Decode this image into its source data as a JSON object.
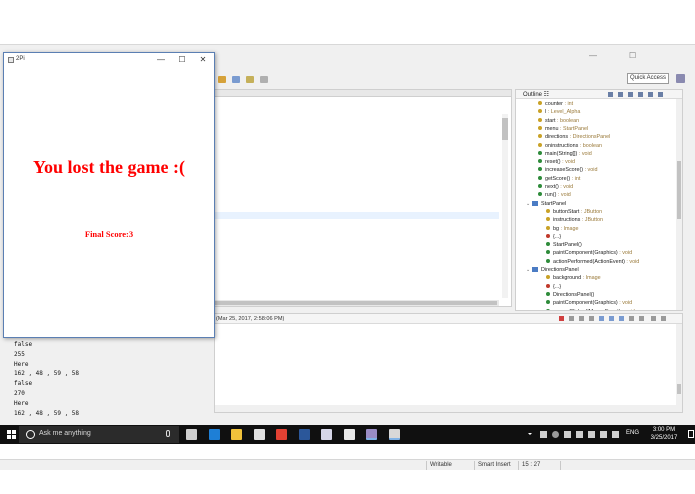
{
  "app_window": {
    "title": "2Pi",
    "minimize_glyph": "—",
    "maximize_glyph": "☐",
    "close_glyph": "✕",
    "message": "You lost the game :(",
    "score_text": "Final Score:3",
    "message_color": "#ff0000"
  },
  "ide": {
    "caption_minimize": "—",
    "caption_maximize": "☐",
    "quick_access": "Quick Access",
    "outline": {
      "title": "Outline ☷",
      "items": [
        {
          "indent": 0,
          "icon": "field",
          "color": "#c9a227",
          "name": "counter",
          "type": ": int"
        },
        {
          "indent": 0,
          "icon": "field",
          "color": "#c9a227",
          "name": "l",
          "type": ": Level_Alpha"
        },
        {
          "indent": 0,
          "icon": "field",
          "color": "#c9a227",
          "name": "start",
          "type": ": boolean"
        },
        {
          "indent": 0,
          "icon": "field",
          "color": "#c9a227",
          "name": "menu",
          "type": ": StartPanel"
        },
        {
          "indent": 0,
          "icon": "field",
          "color": "#c9a227",
          "name": "directions",
          "type": ": DirectionsPanel"
        },
        {
          "indent": 0,
          "icon": "field",
          "color": "#c9a227",
          "name": "oninstructions",
          "type": ": boolean"
        },
        {
          "indent": 0,
          "icon": "method",
          "color": "#2e8b3a",
          "name": "main(String[])",
          "type": ": void"
        },
        {
          "indent": 0,
          "icon": "method",
          "color": "#2e8b3a",
          "name": "reset()",
          "type": ": void"
        },
        {
          "indent": 0,
          "icon": "method",
          "color": "#2e8b3a",
          "name": "increaseScore()",
          "type": ": void"
        },
        {
          "indent": 0,
          "icon": "method",
          "color": "#2e8b3a",
          "name": "getScore()",
          "type": ": int"
        },
        {
          "indent": 0,
          "icon": "method",
          "color": "#2e8b3a",
          "name": "next()",
          "type": ": void"
        },
        {
          "indent": 0,
          "icon": "method",
          "color": "#2e8b3a",
          "name": "run()",
          "type": ": void"
        },
        {
          "indent": -1,
          "icon": "class",
          "color": "#4b7cc4",
          "name": "StartPanel",
          "type": ""
        },
        {
          "indent": 1,
          "icon": "field",
          "color": "#c9a227",
          "name": "buttonStart",
          "type": ": JButton"
        },
        {
          "indent": 1,
          "icon": "field",
          "color": "#c9a227",
          "name": "instructions",
          "type": ": JButton"
        },
        {
          "indent": 1,
          "icon": "field",
          "color": "#c9a227",
          "name": "bg",
          "type": ": Image"
        },
        {
          "indent": 1,
          "icon": "init",
          "color": "#c0392b",
          "name": "{...}",
          "type": ""
        },
        {
          "indent": 1,
          "icon": "method",
          "color": "#2e8b3a",
          "name": "StartPanel()",
          "type": ""
        },
        {
          "indent": 1,
          "icon": "method",
          "color": "#2e8b3a",
          "name": "paintComponent(Graphics)",
          "type": ": void"
        },
        {
          "indent": 1,
          "icon": "method",
          "color": "#2e8b3a",
          "name": "actionPerformed(ActionEvent)",
          "type": ": void"
        },
        {
          "indent": -1,
          "icon": "class",
          "color": "#4b7cc4",
          "name": "DirectionsPanel",
          "type": ""
        },
        {
          "indent": 1,
          "icon": "field",
          "color": "#c9a227",
          "name": "background",
          "type": ": Image"
        },
        {
          "indent": 1,
          "icon": "init",
          "color": "#c0392b",
          "name": "{...}",
          "type": ""
        },
        {
          "indent": 1,
          "icon": "method",
          "color": "#2e8b3a",
          "name": "DirectionsPanel()",
          "type": ""
        },
        {
          "indent": 1,
          "icon": "method",
          "color": "#2e8b3a",
          "name": "paintComponent(Graphics)",
          "type": ": void"
        },
        {
          "indent": 1,
          "icon": "method",
          "color": "#2e8b3a",
          "name": "mouseClicked(MouseEvent)",
          "type": ": void"
        }
      ]
    },
    "console": {
      "terminated": "(Mar 25, 2017, 2:58:06 PM)",
      "output": "false\n255\nHere\n162 , 48 , 59 , 58\nfalse\n270\nHere\n162 , 48 , 59 , 58"
    },
    "status": {
      "writable": "Writable",
      "insert_mode": "Smart Insert",
      "position": "15 : 27"
    }
  },
  "taskbar": {
    "search_placeholder": "Ask me anything",
    "language": "ENG",
    "time": "3:00 PM",
    "date": "3/25/2017",
    "apps": [
      {
        "name": "task-view-icon",
        "color": "#cfcfcf",
        "active": false
      },
      {
        "name": "edge-icon",
        "color": "#1e7fd6",
        "active": false
      },
      {
        "name": "file-explorer-icon",
        "color": "#f1c23b",
        "active": false
      },
      {
        "name": "store-icon",
        "color": "#e0e0e0",
        "active": false
      },
      {
        "name": "chrome-icon",
        "color": "#e34133",
        "active": false
      },
      {
        "name": "word-icon",
        "color": "#2b579a",
        "active": false
      },
      {
        "name": "media-app-icon",
        "color": "#d6d6e8",
        "active": false
      },
      {
        "name": "calculator-icon",
        "color": "#e8e8e8",
        "active": false
      },
      {
        "name": "eclipse-icon",
        "color": "#9a8cc4",
        "active": true
      },
      {
        "name": "java-app-icon",
        "color": "#d8d8d8",
        "active": true
      }
    ]
  }
}
